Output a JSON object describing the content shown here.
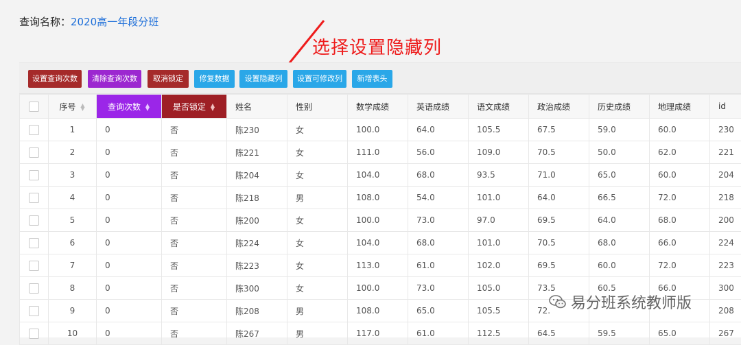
{
  "query": {
    "label": "查询名称：",
    "value": "2020高一年段分班"
  },
  "annotation": {
    "text": "选择设置隐藏列"
  },
  "toolbar": {
    "buttons": [
      {
        "label": "设置查询次数",
        "color": "#a52a2a"
      },
      {
        "label": "清除查询次数",
        "color": "#9c27d0"
      },
      {
        "label": "取消锁定",
        "color": "#a52a2a"
      },
      {
        "label": "修复数据",
        "color": "#2aa7e8"
      },
      {
        "label": "设置隐藏列",
        "color": "#2aa7e8"
      },
      {
        "label": "设置可修改列",
        "color": "#2aa7e8"
      },
      {
        "label": "新增表头",
        "color": "#2aa7e8"
      }
    ]
  },
  "table": {
    "headers": [
      "序号",
      "查询次数",
      "是否锁定",
      "姓名",
      "性别",
      "数学成绩",
      "英语成绩",
      "语文成绩",
      "政治成绩",
      "历史成绩",
      "地理成绩",
      "id"
    ],
    "rows": [
      [
        "1",
        "0",
        "否",
        "陈230",
        "女",
        "100.0",
        "64.0",
        "105.5",
        "67.5",
        "59.0",
        "60.0",
        "230"
      ],
      [
        "2",
        "0",
        "否",
        "陈221",
        "女",
        "111.0",
        "56.0",
        "109.0",
        "70.5",
        "50.0",
        "62.0",
        "221"
      ],
      [
        "3",
        "0",
        "否",
        "陈204",
        "女",
        "104.0",
        "68.0",
        "93.5",
        "71.0",
        "65.0",
        "60.0",
        "204"
      ],
      [
        "4",
        "0",
        "否",
        "陈218",
        "男",
        "108.0",
        "54.0",
        "101.0",
        "64.0",
        "66.5",
        "72.0",
        "218"
      ],
      [
        "5",
        "0",
        "否",
        "陈200",
        "女",
        "100.0",
        "73.0",
        "97.0",
        "69.5",
        "64.0",
        "68.0",
        "200"
      ],
      [
        "6",
        "0",
        "否",
        "陈224",
        "女",
        "104.0",
        "68.0",
        "101.0",
        "70.5",
        "68.0",
        "66.0",
        "224"
      ],
      [
        "7",
        "0",
        "否",
        "陈223",
        "女",
        "113.0",
        "61.0",
        "102.0",
        "69.5",
        "60.0",
        "72.0",
        "223"
      ],
      [
        "8",
        "0",
        "否",
        "陈300",
        "女",
        "100.0",
        "73.0",
        "105.0",
        "73.5",
        "60.5",
        "66.0",
        "300"
      ],
      [
        "9",
        "0",
        "否",
        "陈208",
        "男",
        "108.0",
        "65.0",
        "105.5",
        "72.",
        "",
        "",
        "208"
      ],
      [
        "10",
        "0",
        "否",
        "陈267",
        "男",
        "117.0",
        "61.0",
        "112.5",
        "64.5",
        "59.5",
        "65.0",
        "267"
      ]
    ]
  },
  "watermark": {
    "text": "易分班系统教师版",
    "icon": "wechat-icon"
  },
  "colors": {
    "accent_blue": "#2aa7e8",
    "dark_red": "#a52a2a",
    "purple": "#9c27d0",
    "annotation_red": "#ee1c1c"
  }
}
